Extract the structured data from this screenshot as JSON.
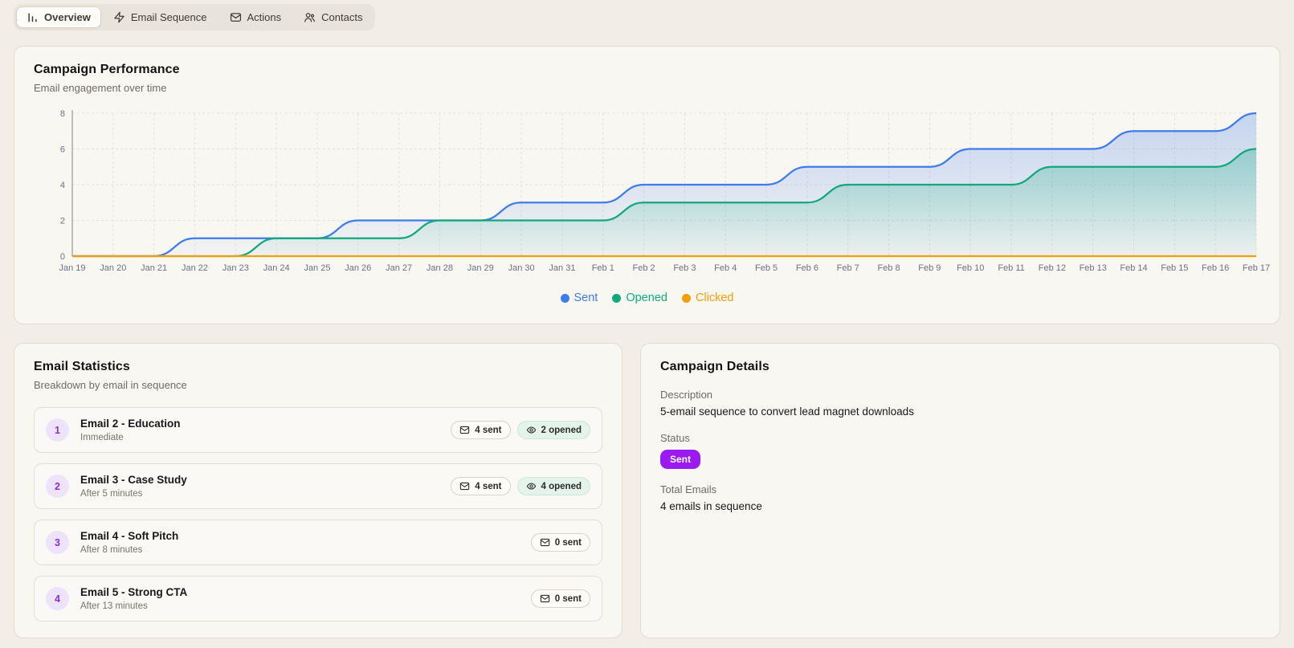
{
  "tabs": [
    {
      "label": "Overview",
      "icon": "bar-chart-icon",
      "active": true
    },
    {
      "label": "Email Sequence",
      "icon": "zap-icon",
      "active": false
    },
    {
      "label": "Actions",
      "icon": "mail-icon",
      "active": false
    },
    {
      "label": "Contacts",
      "icon": "users-icon",
      "active": false
    }
  ],
  "performance": {
    "title": "Campaign Performance",
    "subtitle": "Email engagement over time"
  },
  "chart_data": {
    "type": "area",
    "x": [
      "Jan 19",
      "Jan 20",
      "Jan 21",
      "Jan 22",
      "Jan 23",
      "Jan 24",
      "Jan 25",
      "Jan 26",
      "Jan 27",
      "Jan 28",
      "Jan 29",
      "Jan 30",
      "Jan 31",
      "Feb 1",
      "Feb 2",
      "Feb 3",
      "Feb 4",
      "Feb 5",
      "Feb 6",
      "Feb 7",
      "Feb 8",
      "Feb 9",
      "Feb 10",
      "Feb 11",
      "Feb 12",
      "Feb 13",
      "Feb 14",
      "Feb 15",
      "Feb 16",
      "Feb 17"
    ],
    "series": [
      {
        "name": "Sent",
        "color": "#3f7ceb",
        "values": [
          0,
          0,
          0,
          1,
          1,
          1,
          1,
          2,
          2,
          2,
          2,
          3,
          3,
          3,
          4,
          4,
          4,
          4,
          5,
          5,
          5,
          5,
          6,
          6,
          6,
          6,
          7,
          7,
          7,
          8
        ]
      },
      {
        "name": "Opened",
        "color": "#10a97c",
        "values": [
          0,
          0,
          0,
          0,
          0,
          1,
          1,
          1,
          1,
          2,
          2,
          2,
          2,
          2,
          3,
          3,
          3,
          3,
          3,
          4,
          4,
          4,
          4,
          4,
          5,
          5,
          5,
          5,
          5,
          6
        ]
      },
      {
        "name": "Clicked",
        "color": "#f59e0b",
        "values": [
          0,
          0,
          0,
          0,
          0,
          0,
          0,
          0,
          0,
          0,
          0,
          0,
          0,
          0,
          0,
          0,
          0,
          0,
          0,
          0,
          0,
          0,
          0,
          0,
          0,
          0,
          0,
          0,
          0,
          0
        ]
      }
    ],
    "ylim": [
      0,
      8
    ],
    "yticks": [
      0,
      2,
      4,
      6,
      8
    ],
    "grid": true,
    "legend_position": "bottom",
    "title": "Campaign Performance"
  },
  "stats": {
    "title": "Email Statistics",
    "subtitle": "Breakdown by email in sequence",
    "items": [
      {
        "number": "1",
        "title": "Email 2 - Education",
        "timing": "Immediate",
        "badges": [
          {
            "icon": "mail-icon",
            "label": "4 sent",
            "variant": "sent"
          },
          {
            "icon": "eye-icon",
            "label": "2 opened",
            "variant": "opened"
          }
        ]
      },
      {
        "number": "2",
        "title": "Email 3 - Case Study",
        "timing": "After 5 minutes",
        "badges": [
          {
            "icon": "mail-icon",
            "label": "4 sent",
            "variant": "sent"
          },
          {
            "icon": "eye-icon",
            "label": "4 opened",
            "variant": "opened"
          }
        ]
      },
      {
        "number": "3",
        "title": "Email 4 - Soft Pitch",
        "timing": "After 8 minutes",
        "badges": [
          {
            "icon": "mail-icon",
            "label": "0 sent",
            "variant": "sent"
          }
        ]
      },
      {
        "number": "4",
        "title": "Email 5 - Strong CTA",
        "timing": "After 13 minutes",
        "badges": [
          {
            "icon": "mail-icon",
            "label": "0 sent",
            "variant": "sent"
          }
        ]
      }
    ]
  },
  "details": {
    "title": "Campaign Details",
    "description_label": "Description",
    "description_value": "5-email sequence to convert lead magnet downloads",
    "status_label": "Status",
    "status_badge": "Sent",
    "total_label": "Total Emails",
    "total_value": "4 emails in sequence"
  },
  "colors": {
    "status_purple": "#9b1af0",
    "sent_blue": "#3f7ceb",
    "opened_green": "#10a97c",
    "clicked_orange": "#f59e0b",
    "grid_line": "#e5e1d8",
    "axis_text": "#6b7280"
  }
}
